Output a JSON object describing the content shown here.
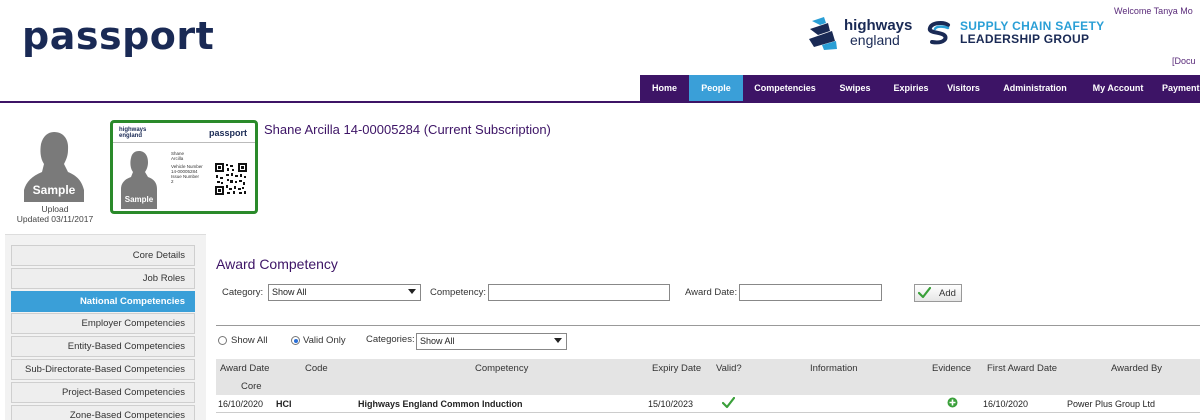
{
  "app": {
    "logo": "passport",
    "welcome": "Welcome Tanya Mo",
    "doc_link": "[Docu",
    "highways_line1": "highways",
    "highways_line2": "england",
    "supply_line1": "SUPPLY CHAIN SAFETY",
    "supply_line2": "LEADERSHIP GROUP"
  },
  "nav": {
    "items": [
      {
        "label": "Home"
      },
      {
        "label": "People",
        "active": true
      },
      {
        "label": "Competencies"
      },
      {
        "label": "Swipes"
      },
      {
        "label": "Expiries"
      },
      {
        "label": "Visitors"
      },
      {
        "label": "Administration"
      },
      {
        "label": "My Account"
      },
      {
        "label": "Payment"
      }
    ]
  },
  "profile": {
    "photo_watermark": "Sample",
    "upload_label": "Upload",
    "updated_label": "Updated 03/11/2017",
    "title": "Shane Arcilla 14-00005284 (Current Subscription)",
    "card": {
      "brand_line1": "highways",
      "brand_line2": "england",
      "passport": "passport",
      "name_line1": "Shane",
      "name_line2": "Arcilla",
      "vn_label": "Vehicle Number",
      "vn_value": "14-00005284",
      "issue_label": "Issue Number",
      "issue_value": "2",
      "watermark": "Sample"
    }
  },
  "sidebar": {
    "items": [
      {
        "label": "Core Details"
      },
      {
        "label": "Job Roles"
      },
      {
        "label": "National Competencies",
        "active": true
      },
      {
        "label": "Employer Competencies"
      },
      {
        "label": "Entity-Based Competencies"
      },
      {
        "label": "Sub-Directorate-Based Competencies"
      },
      {
        "label": "Project-Based Competencies"
      },
      {
        "label": "Zone-Based Competencies"
      }
    ]
  },
  "award": {
    "title": "Award Competency",
    "category_label": "Category:",
    "category_value": "Show All",
    "competency_label": "Competency:",
    "competency_value": "",
    "award_date_label": "Award Date:",
    "award_date_value": "",
    "add_label": "Add"
  },
  "filters": {
    "show_all": "Show All",
    "valid_only": "Valid Only",
    "selected": "valid_only",
    "categories_label": "Categories:",
    "categories_value": "Show All"
  },
  "table": {
    "headers": {
      "award_date": "Award Date",
      "code": "Code",
      "competency": "Competency",
      "expiry_date": "Expiry Date",
      "valid": "Valid?",
      "information": "Information",
      "evidence": "Evidence",
      "first_award_date": "First Award Date",
      "awarded_by": "Awarded By"
    },
    "group": "Core",
    "rows": [
      {
        "award_date": "16/10/2020",
        "code": "HCI",
        "competency": "Highways England Common Induction",
        "expiry_date": "15/10/2023",
        "valid": true,
        "information": "",
        "evidence": "add",
        "first_award_date": "16/10/2020",
        "awarded_by": "Power Plus Group Ltd"
      }
    ]
  },
  "colors": {
    "brand_purple": "#3d1466",
    "accent_blue": "#3a9fd8",
    "valid_green": "#3aa03a"
  }
}
